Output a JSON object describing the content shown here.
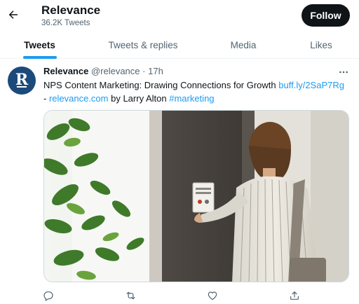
{
  "header": {
    "back_icon": "arrow-left-icon",
    "title": "Relevance",
    "tweet_count": "36.2K Tweets",
    "follow_label": "Follow"
  },
  "tabs": [
    {
      "label": "Tweets",
      "active": true
    },
    {
      "label": "Tweets & replies",
      "active": false
    },
    {
      "label": "Media",
      "active": false
    },
    {
      "label": "Likes",
      "active": false
    }
  ],
  "tweet": {
    "avatar_letter": "R",
    "author_name": "Relevance",
    "handle": "@relevance",
    "separator": "·",
    "time": "17h",
    "more_icon": "more-horizontal-icon",
    "text_part1": "NPS Content Marketing: Drawing Connections for Growth ",
    "link1": "buff.ly/2SaP7Rg",
    "text_part2": "- ",
    "link2": "relevance.com",
    "text_part3": " by Larry Alton ",
    "hashtag": "#marketing",
    "media_sign_text": "How was your day?",
    "actions": [
      {
        "name": "reply-icon"
      },
      {
        "name": "retweet-icon"
      },
      {
        "name": "like-icon"
      },
      {
        "name": "share-icon"
      }
    ]
  },
  "colors": {
    "accent": "#1d9bf0",
    "text_primary": "#0f1419",
    "text_secondary": "#536471",
    "avatar_bg": "#1c4a7a",
    "follow_bg": "#0f1419"
  }
}
